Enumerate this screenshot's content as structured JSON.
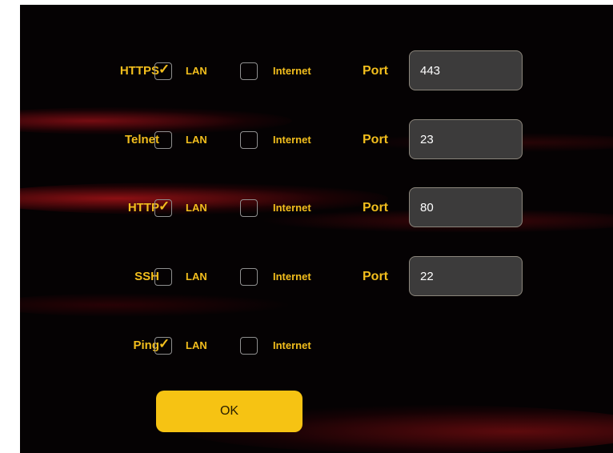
{
  "port_label": "Port",
  "lan_label": "LAN",
  "internet_label": "Internet",
  "ok_label": "OK",
  "services": [
    {
      "name": "HTTPS",
      "lan": true,
      "internet": false,
      "port": "443"
    },
    {
      "name": "Telnet",
      "lan": false,
      "internet": false,
      "port": "23"
    },
    {
      "name": "HTTP",
      "lan": true,
      "internet": false,
      "port": "80"
    },
    {
      "name": "SSH",
      "lan": false,
      "internet": false,
      "port": "22"
    },
    {
      "name": "Ping",
      "lan": true,
      "internet": false
    }
  ],
  "colors": {
    "accent": "#f2be1d",
    "button": "#f6c313",
    "background": "#050203"
  }
}
